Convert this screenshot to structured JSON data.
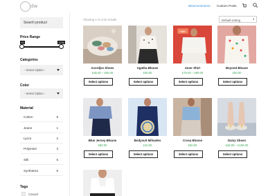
{
  "header": {
    "logo_text": "dw",
    "nav": [
      {
        "label": "WooCommerce",
        "active": true
      },
      {
        "label": "Custom Posts",
        "active": false
      }
    ],
    "icons": [
      "cart-icon",
      "search-icon"
    ],
    "accent_color": "#2a8bd6"
  },
  "sidebar": {
    "search_placeholder": "Search product",
    "price_range": {
      "title": "Price Range",
      "min_label": "£0",
      "max_label": "£200"
    },
    "categories": {
      "title": "Categories",
      "selected": "- Select Option -"
    },
    "color": {
      "title": "Color",
      "selected": "- Select Option -"
    },
    "material": {
      "title": "Material",
      "items": [
        {
          "label": "Cotton",
          "count": "9"
        },
        {
          "label": "Jeans",
          "count": "1"
        },
        {
          "label": "Lycra",
          "count": "2"
        },
        {
          "label": "Polyester",
          "count": "3"
        },
        {
          "label": "Silk",
          "count": "5"
        },
        {
          "label": "Synthetics",
          "count": "5"
        }
      ]
    },
    "tags": {
      "title": "Tags",
      "first_item": "Casual"
    }
  },
  "shop": {
    "showing": "Showing 1–9 of 20 results",
    "sort_selected": "Default sorting",
    "price_color": "#3aa655",
    "sale_color": "#ef7b57",
    "products": [
      {
        "name": "Acerdjes Shoes",
        "price": "£35.00 – £50.00",
        "button": "Select options",
        "sale": ""
      },
      {
        "name": "Agatha Blouse",
        "price": "£30.00",
        "button": "Select options",
        "sale": ""
      },
      {
        "name": "Amer Shirt",
        "price": "£75.00 – £90.00",
        "button": "Select options",
        "sale": "Sale!"
      },
      {
        "name": "Beyond Blouse",
        "price": "£30.00",
        "button": "Select options",
        "sale": ""
      },
      {
        "name": "Blue Jersey Blouse",
        "price": "£90.00",
        "button": "Select options",
        "sale": ""
      },
      {
        "name": "Bodysuit Milnades",
        "price": "£15.00",
        "button": "Select options",
        "sale": ""
      },
      {
        "name": "Crosa Blouse",
        "price": "£60.00",
        "button": "Select options",
        "sale": ""
      },
      {
        "name": "Daisy Shoes",
        "price": "£48.00 – £150.00",
        "button": "Select options",
        "sale": ""
      },
      {
        "name": "",
        "price": "",
        "button": "",
        "sale": ""
      }
    ]
  }
}
